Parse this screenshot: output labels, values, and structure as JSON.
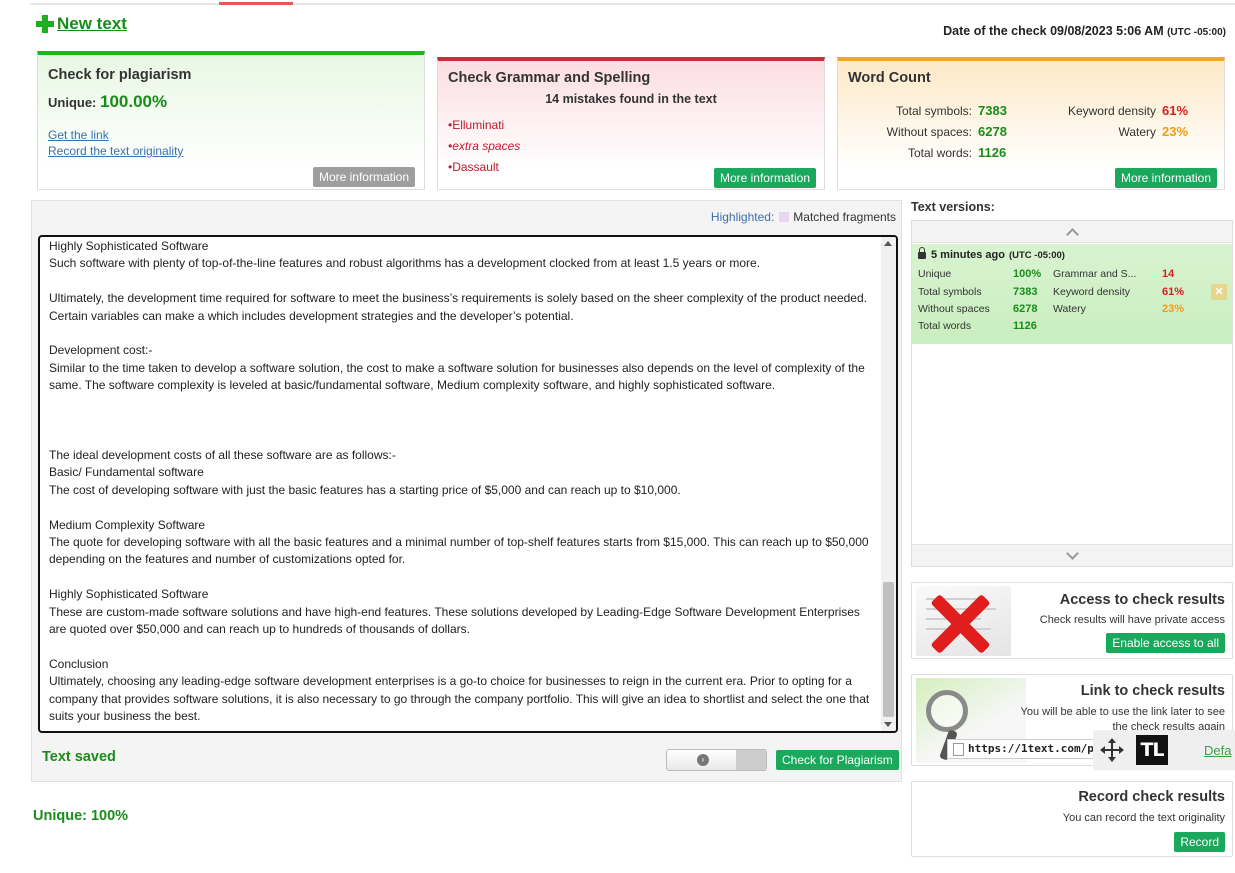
{
  "header": {
    "new_text": "New text",
    "date_label": "Date of the check 09/08/2023 5:06 AM",
    "date_tz": "(UTC -05:00)"
  },
  "plagiarism_card": {
    "title": "Check for plagiarism",
    "unique_label": "Unique:",
    "unique_value": "100.00%",
    "link_get": "Get the link",
    "link_record": "Record the text originality",
    "more": "More information"
  },
  "grammar_card": {
    "title": "Check Grammar and Spelling",
    "summary": "14 mistakes found in the text",
    "mistakes": [
      "Elluminati",
      "extra spaces",
      "Dassault"
    ],
    "more": "More information"
  },
  "word_card": {
    "title": "Word Count",
    "total_symbols_label": "Total symbols:",
    "total_symbols": "7383",
    "without_spaces_label": "Without spaces:",
    "without_spaces": "6278",
    "total_words_label": "Total words:",
    "total_words": "1126",
    "keyword_density_label": "Keyword density",
    "keyword_density": "61%",
    "watery_label": "Watery",
    "watery": "23%",
    "more": "More information"
  },
  "editor": {
    "highlighted_label": "Highlighted:",
    "matched_label": "Matched fragments",
    "text": "Highly Sophisticated Software\nSuch software with plenty of top-of-the-line features and robust algorithms has a development clocked from at least 1.5 years or more.\n\nUltimately, the development time required for software to meet the business’s requirements is solely based on the sheer complexity of the product needed. Certain variables can make a which includes development strategies and the developer’s potential.\n\nDevelopment cost:-\nSimilar to the time taken to develop a software solution, the cost to make a software solution for businesses also depends on the level of complexity of the same. The software complexity is leveled at basic/fundamental software, Medium complexity software, and highly sophisticated software.\n\n\n\nThe ideal development costs of all these software are as follows:-\nBasic/ Fundamental software\nThe cost of developing software with just the basic features has a starting price of $5,000 and can reach up to $10,000.\n\nMedium Complexity Software\nThe quote for developing software with all the basic features and a minimal number of top-shelf features starts from $15,000. This can reach up to $50,000 depending on the features and number of customizations opted for.\n\nHighly Sophisticated Software\nThese are custom-made software solutions and have high-end features. These solutions developed by Leading-Edge Software Development Enterprises are quoted over $50,000 and can reach up to hundreds of thousands of dollars.\n\nConclusion\nUltimately, choosing any leading-edge software development enterprises is a go-to choice for businesses to reign in the current era. Prior to opting for a company that provides software solutions, it is also necessary to go through the company portfolio. This will give an idea to shortlist and select the one that suits your business the best.",
    "saved": "Text saved",
    "check_button": "Check for Plagiarism"
  },
  "unique_bottom": "Unique: 100%",
  "versions": {
    "title": "Text versions:",
    "item": {
      "time": "5 minutes ago",
      "tz": "(UTC -05:00)",
      "unique_label": "Unique",
      "unique": "100%",
      "total_symbols_label": "Total symbols",
      "total_symbols": "7383",
      "without_spaces_label": "Without spaces",
      "without_spaces": "6278",
      "total_words_label": "Total words",
      "total_words": "1126",
      "grammar_label": "Grammar and S...",
      "grammar": "14",
      "keyword_label": "Keyword density",
      "keyword": "61%",
      "watery_label": "Watery",
      "watery": "23%"
    }
  },
  "access_card": {
    "title": "Access to check results",
    "desc": "Check results will have private access",
    "button": "Enable access to all"
  },
  "link_card": {
    "title": "Link to check results",
    "desc": "You will be able to use the link later to see the check results again",
    "url": "https://1text.com/pla"
  },
  "record_card": {
    "title": "Record check results",
    "desc": "You can record the text originality",
    "button": "Record"
  },
  "overlay": {
    "badge": "TL",
    "link": "Defa"
  },
  "colors": {
    "green_accent": "#1aa85c",
    "success_text": "#1a8c1a",
    "error_red": "#d62020",
    "warning_orange": "#f19b1a"
  }
}
